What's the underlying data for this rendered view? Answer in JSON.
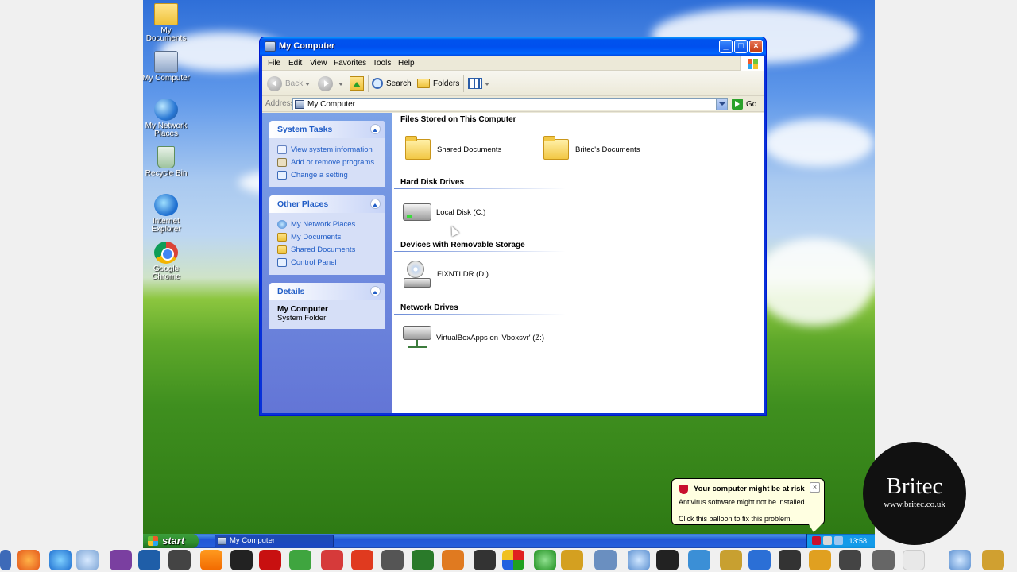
{
  "desktop": {
    "icons": [
      {
        "label": "My Documents",
        "icon": "my-documents-icon"
      },
      {
        "label": "My Computer",
        "icon": "my-computer-icon"
      },
      {
        "label": "My Network Places",
        "icon": "network-places-icon"
      },
      {
        "label": "Recycle Bin",
        "icon": "recycle-bin-icon"
      },
      {
        "label": "Internet Explorer",
        "icon": "internet-explorer-icon"
      },
      {
        "label": "Google Chrome",
        "icon": "chrome-icon"
      }
    ]
  },
  "window": {
    "title": "My Computer",
    "menu": [
      "File",
      "Edit",
      "View",
      "Favorites",
      "Tools",
      "Help"
    ],
    "toolbar": {
      "back": "Back",
      "search": "Search",
      "folders": "Folders"
    },
    "address": {
      "label": "Address",
      "value": "My Computer",
      "go": "Go"
    },
    "left_panels": {
      "system_tasks": {
        "title": "System Tasks",
        "links": [
          "View system information",
          "Add or remove programs",
          "Change a setting"
        ]
      },
      "other_places": {
        "title": "Other Places",
        "links": [
          "My Network Places",
          "My Documents",
          "Shared Documents",
          "Control Panel"
        ]
      },
      "details": {
        "title": "Details",
        "name": "My Computer",
        "type": "System Folder"
      }
    },
    "groups": {
      "files_stored": {
        "title": "Files Stored on This Computer",
        "items": [
          "Shared Documents",
          "Britec's Documents"
        ]
      },
      "hard_disks": {
        "title": "Hard Disk Drives",
        "items": [
          "Local Disk (C:)"
        ]
      },
      "removable": {
        "title": "Devices with Removable Storage",
        "items": [
          "FIXNTLDR (D:)"
        ]
      },
      "network": {
        "title": "Network Drives",
        "items": [
          "VirtualBoxApps on 'Vboxsvr' (Z:)"
        ]
      }
    }
  },
  "taskbar": {
    "start": "start",
    "task": "My Computer",
    "clock": "13:58"
  },
  "balloon": {
    "title": "Your computer might be at risk",
    "line1": "Antivirus software might not be installed",
    "line2": "Click this balloon to fix this problem."
  },
  "watermark": {
    "name": "Britec",
    "url": "www.britec.co.uk"
  },
  "colors": {
    "xp_blue": "#0053ee",
    "task_pane": "#7ba2e7",
    "link_blue": "#215dc6",
    "balloon_bg": "#ffffe1"
  }
}
